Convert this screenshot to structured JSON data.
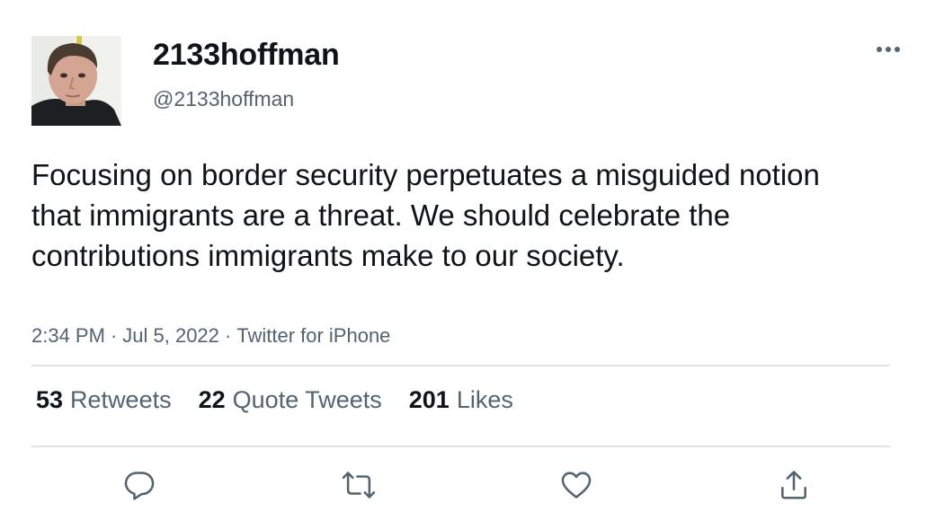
{
  "author": {
    "display_name": "2133hoffman",
    "handle": "@2133hoffman",
    "avatar_icon": "profile-photo"
  },
  "tweet": {
    "text": "Focusing on border security perpetuates a misguided notion that immigrants are a threat. We should celebrate the contributions immigrants make to our society.",
    "time": "2:34 PM",
    "date": "Jul 5, 2022",
    "source": "Twitter for iPhone",
    "separator": "·"
  },
  "stats": {
    "retweets": {
      "count": "53",
      "label": "Retweets"
    },
    "quotes": {
      "count": "22",
      "label": "Quote Tweets"
    },
    "likes": {
      "count": "201",
      "label": "Likes"
    }
  },
  "actions": {
    "reply_icon": "reply-icon",
    "retweet_icon": "retweet-icon",
    "like_icon": "heart-icon",
    "share_icon": "share-icon"
  },
  "colors": {
    "text": "#0f1419",
    "secondary": "#536471",
    "divider": "#dfe3e7"
  }
}
